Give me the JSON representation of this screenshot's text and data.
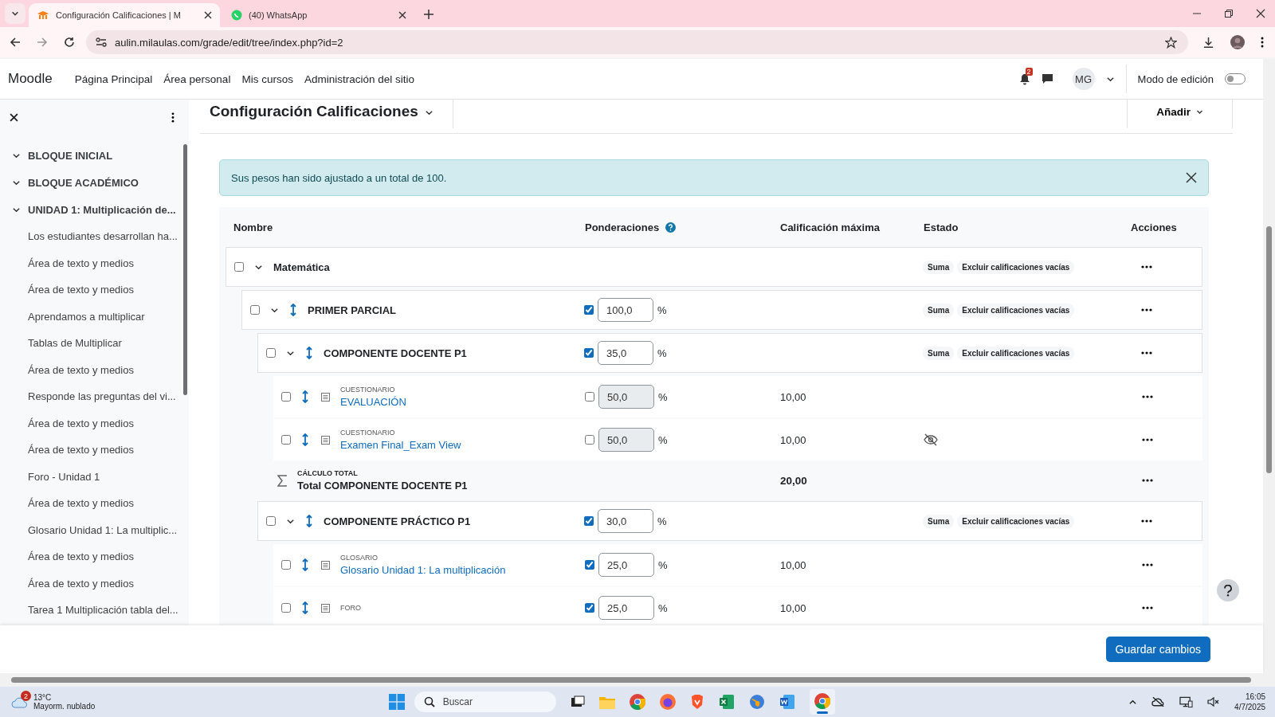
{
  "browser": {
    "tabs": [
      {
        "title": "Configuración Calificaciones | M",
        "selected": true,
        "kind": "site"
      },
      {
        "title": "(40) WhatsApp",
        "selected": false,
        "kind": "chat"
      }
    ],
    "url": "aulin.milaulas.com/grade/edit/tree/index.php?id=2"
  },
  "navbar": {
    "brand": "Moodle",
    "links": [
      {
        "label": "Página Principal"
      },
      {
        "label": "Área personal"
      },
      {
        "label": "Mis cursos"
      },
      {
        "label": "Administración del sitio"
      }
    ],
    "notification_count": "2",
    "avatar": "MG",
    "edit_mode": {
      "label": "Modo de edición",
      "on": false
    }
  },
  "sidebar": {
    "sections": [
      {
        "title": "BLOQUE INICIAL",
        "expanded": true
      },
      {
        "title": "BLOQUE ACADÉMICO",
        "expanded": true
      },
      {
        "title": "UNIDAD 1: Multiplicación de...",
        "expanded": true,
        "children": [
          {
            "label": "Los estudiantes desarrollan ha..."
          },
          {
            "label": "Área de texto y medios"
          },
          {
            "label": "Área de texto y medios"
          },
          {
            "label": "Aprendamos a multiplicar"
          },
          {
            "label": "Tablas de Multiplicar"
          },
          {
            "label": "Área de texto y medios"
          },
          {
            "label": "Responde las preguntas del vi..."
          },
          {
            "label": "Área de texto y medios"
          },
          {
            "label": "Área de texto y medios"
          },
          {
            "label": "Foro - Unidad 1"
          },
          {
            "label": "Área de texto y medios"
          },
          {
            "label": "Glosario Unidad 1: La multiplic..."
          },
          {
            "label": "Área de texto y medios"
          },
          {
            "label": "Área de texto y medios"
          },
          {
            "label": "Tarea 1 Multiplicación tabla del..."
          }
        ]
      }
    ]
  },
  "page": {
    "title": "Configuración Calificaciones",
    "add_button": "Añadir"
  },
  "alert": {
    "text": "Sus pesos han sido ajustado a un total de 100.",
    "dismissible": true
  },
  "table": {
    "columns": [
      "Nombre",
      "Ponderaciones",
      "Calificación máxima",
      "Estado",
      "Acciones"
    ],
    "rows": [
      {
        "kind": "category",
        "name": "Matemática",
        "checked": false,
        "expanded": true,
        "badges": [
          "Suma",
          "Excluir calificaciones vacías"
        ],
        "children": [
          {
            "kind": "category",
            "name": "PRIMER PARCIAL",
            "checked": false,
            "expanded": true,
            "weight": {
              "override": true,
              "value": "100,0",
              "unit": "%"
            },
            "badges": [
              "Suma",
              "Excluir calificaciones vacías"
            ],
            "children": [
              {
                "kind": "category",
                "name": "COMPONENTE DOCENTE P1",
                "checked": false,
                "expanded": true,
                "weight": {
                  "override": true,
                  "value": "35,0",
                  "unit": "%"
                },
                "badges": [
                  "Suma",
                  "Excluir calificaciones vacías"
                ],
                "children": [
                  {
                    "kind": "item",
                    "type_label": "CUESTIONARIO",
                    "name": "EVALUACIÓN",
                    "checked": false,
                    "weight": {
                      "override": false,
                      "value": "50,0",
                      "unit": "%"
                    },
                    "max": "10,00",
                    "hidden": false
                  },
                  {
                    "kind": "item",
                    "type_label": "CUESTIONARIO",
                    "name": "Examen Final_Exam View",
                    "checked": false,
                    "weight": {
                      "override": false,
                      "value": "50,0",
                      "unit": "%"
                    },
                    "max": "10,00",
                    "hidden": true
                  },
                  {
                    "kind": "total",
                    "type_label": "CÁLCULO TOTAL",
                    "name": "Total COMPONENTE DOCENTE P1",
                    "max": "20,00"
                  }
                ]
              },
              {
                "kind": "category",
                "name": "COMPONENTE PRÁCTICO P1",
                "checked": false,
                "expanded": true,
                "weight": {
                  "override": true,
                  "value": "30,0",
                  "unit": "%"
                },
                "badges": [
                  "Suma",
                  "Excluir calificaciones vacías"
                ],
                "children": [
                  {
                    "kind": "item",
                    "type_label": "GLOSARIO",
                    "name": "Glosario Unidad 1: La multiplicación",
                    "checked": false,
                    "weight": {
                      "override": true,
                      "value": "25,0",
                      "unit": "%"
                    },
                    "max": "10,00",
                    "hidden": false
                  },
                  {
                    "kind": "item",
                    "type_label": "FORO",
                    "checked": false,
                    "weight": {
                      "override": true,
                      "value": "25,0",
                      "unit": "%"
                    },
                    "max": "10,00",
                    "hidden": false
                  }
                ]
              }
            ]
          }
        ]
      }
    ]
  },
  "footer": {
    "save_button": "Guardar cambios"
  },
  "taskbar": {
    "weather_badge": "2",
    "temperature": "13°C",
    "condition": "Mayorm. nublado",
    "search_placeholder": "Buscar",
    "time": "16:05",
    "date": "4/7/2025"
  }
}
